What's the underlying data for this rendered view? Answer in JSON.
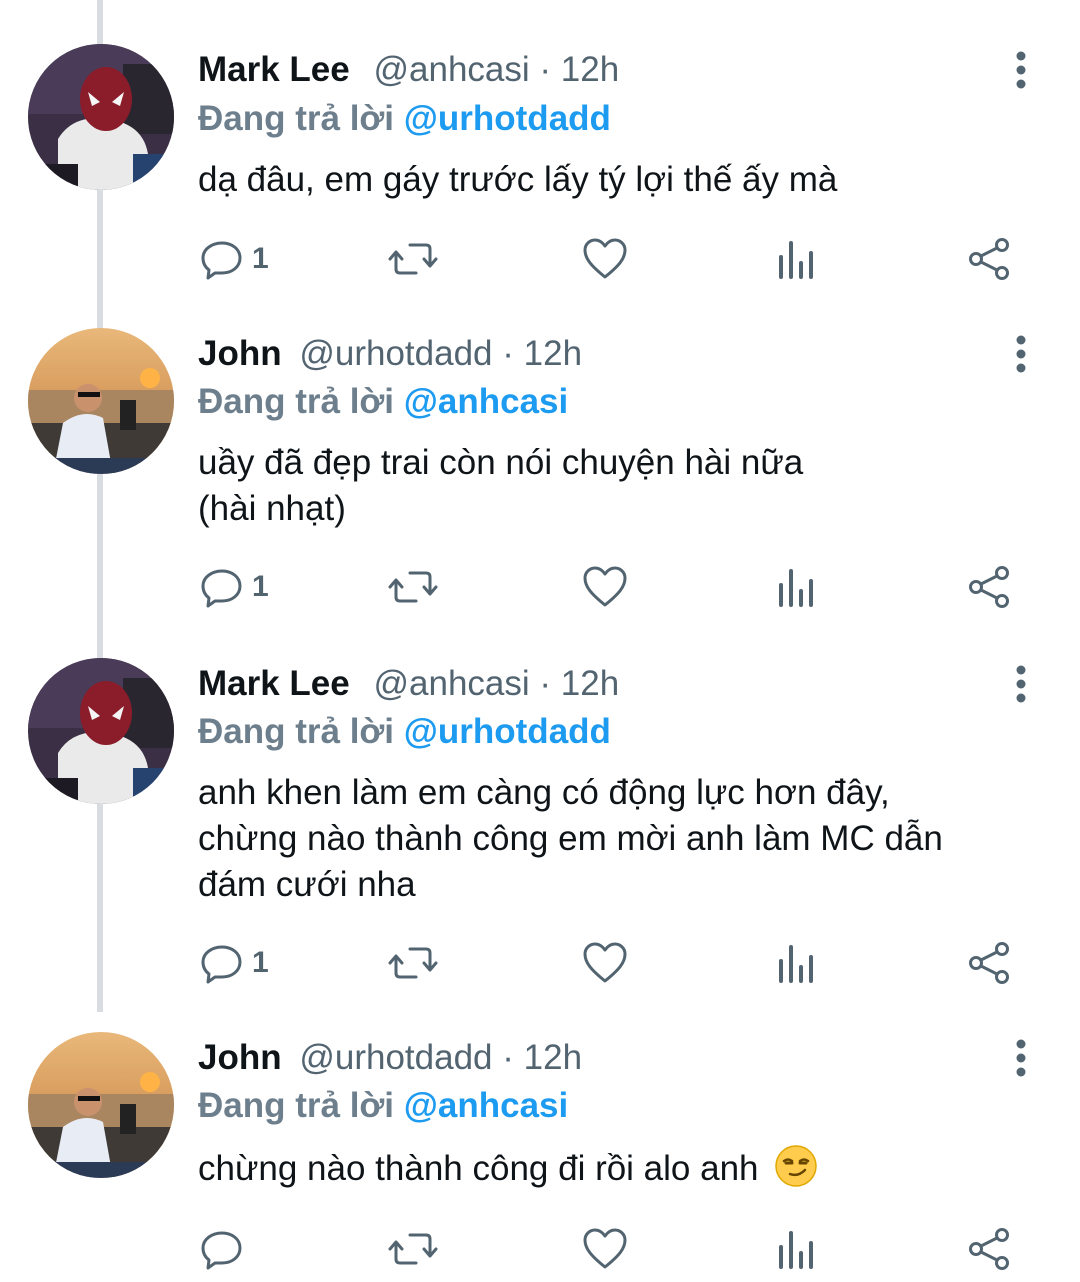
{
  "tweets": [
    {
      "name": "Mark Lee",
      "handle": "@anhcasi",
      "separator": "·",
      "time": "12h",
      "replying_label": "Đang trả lời",
      "replying_to": "@urhotdadd",
      "text": "dạ đâu, em gáy trước lấy tý lợi thế ấy mà",
      "reply_count": "1",
      "avatar": "spiderman-mask-avatar"
    },
    {
      "name": "John",
      "handle": "@urhotdadd",
      "separator": "·",
      "time": "12h",
      "replying_label": "Đang trả lời",
      "replying_to": "@anhcasi",
      "text_lines": [
        "uầy đã đẹp trai còn nói chuyện hài nữa",
        "(hài nhạt)"
      ],
      "reply_count": "1",
      "avatar": "sunset-beach-avatar"
    },
    {
      "name": "Mark Lee",
      "handle": "@anhcasi",
      "separator": "·",
      "time": "12h",
      "replying_label": "Đang trả lời",
      "replying_to": "@urhotdadd",
      "text_lines": [
        "anh khen làm em càng có động lực hơn đây,",
        "chừng nào thành công em mời anh làm MC dẫn",
        "đám cưới nha"
      ],
      "reply_count": "1",
      "avatar": "spiderman-mask-avatar"
    },
    {
      "name": "John",
      "handle": "@urhotdadd",
      "separator": "·",
      "time": "12h",
      "replying_label": "Đang trả lời",
      "replying_to": "@anhcasi",
      "text": "chừng nào thành công đi rồi alo anh",
      "emoji": "smirking-face-emoji",
      "reply_count": "",
      "avatar": "sunset-beach-avatar"
    }
  ],
  "icons": {
    "reply": "reply-icon",
    "retweet": "retweet-icon",
    "like": "like-icon",
    "views": "views-icon",
    "share": "share-icon",
    "more": "more-vertical-icon"
  },
  "colors": {
    "text": "#0f1419",
    "secondary": "#536471",
    "mention": "#1d9bf0",
    "thread_line": "#d9dde1"
  }
}
